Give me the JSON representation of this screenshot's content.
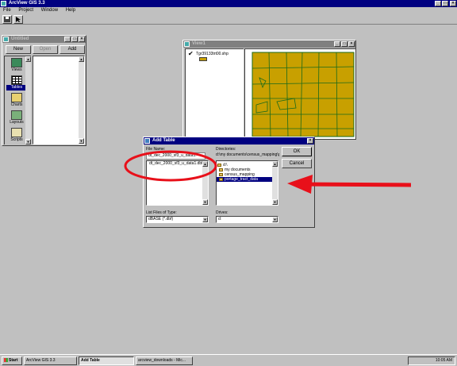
{
  "app": {
    "title": "ArcView GIS 3.3",
    "menus": [
      "File",
      "Project",
      "Window",
      "Help"
    ]
  },
  "project_window": {
    "title": "Untitled",
    "buttons": {
      "new": "New",
      "open": "Open",
      "add": "Add"
    },
    "items": [
      {
        "label": "Views",
        "icon": "views-icon",
        "selected": false
      },
      {
        "label": "Tables",
        "icon": "tables-icon",
        "selected": true
      },
      {
        "label": "Charts",
        "icon": "charts-icon",
        "selected": false
      },
      {
        "label": "Layouts",
        "icon": "layouts-icon",
        "selected": false
      },
      {
        "label": "Scripts",
        "icon": "scripts-icon",
        "selected": false
      }
    ]
  },
  "view_window": {
    "title": "View1",
    "layer_name": "Tgr39133trt00.shp",
    "map_fill": "#c8a000",
    "map_border": "#1a6a1a"
  },
  "dialog": {
    "title": "Add Table",
    "file_name_label": "File Name:",
    "file_name_value": "dt_dec_2000_sf3_u_data1.",
    "files": [
      "dt_dec_2000_sf3_u_data1.dbf"
    ],
    "directories_label": "Directories:",
    "directories_path": "d:\\my documents\\census_mapping\\p",
    "directories": [
      {
        "label": "d:\\",
        "selected": false
      },
      {
        "label": "my documents",
        "selected": false
      },
      {
        "label": "census_mapping",
        "selected": false
      },
      {
        "label": "portage_tract_data",
        "selected": true
      }
    ],
    "ok": "OK",
    "cancel": "Cancel",
    "file_type_label": "List Files of Type:",
    "file_type_value": "dBASE (*.dbf)",
    "drives_label": "Drives:",
    "drives_value": "d:"
  },
  "annotation": {
    "color": "#e8101a"
  },
  "taskbar": {
    "start": "Start",
    "tasks": [
      {
        "label": "ArcView GIS 3.3",
        "active": false
      },
      {
        "label": "Add Table",
        "active": true
      },
      {
        "label": "arcview_downloads - Mic...",
        "active": false
      }
    ],
    "clock": "10:05 AM"
  }
}
